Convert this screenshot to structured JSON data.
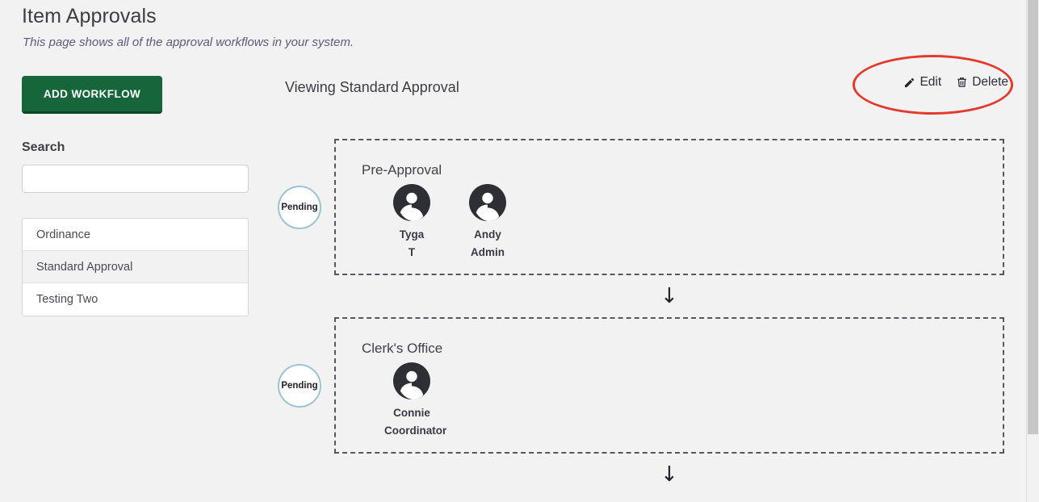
{
  "page": {
    "title": "Item Approvals",
    "subtitle": "This page shows all of the approval workflows in your system.",
    "background_color": "#f2f2f2"
  },
  "sidebar": {
    "add_workflow_label": "ADD WORKFLOW",
    "add_workflow_color": "#17653a",
    "search_label": "Search",
    "search_value": "",
    "search_placeholder": "",
    "workflows": [
      {
        "label": "Ordinance",
        "selected": false
      },
      {
        "label": "Standard Approval",
        "selected": true
      },
      {
        "label": "Testing Two",
        "selected": false
      }
    ]
  },
  "main": {
    "viewing_title": "Viewing Standard Approval",
    "actions": [
      {
        "label": "Edit",
        "icon": "pencil-icon"
      },
      {
        "label": "Delete",
        "icon": "trash-icon"
      }
    ],
    "annotation": {
      "shape": "ellipse",
      "color": "#e23b2e",
      "target": "edit-delete-actions"
    },
    "steps": [
      {
        "status": "Pending",
        "status_border_color": "#9dc3d4",
        "title": "Pre-Approval",
        "approvers": [
          {
            "first_name": "Tyga",
            "last_name": "T",
            "icon": "account-circle-icon"
          },
          {
            "first_name": "Andy",
            "last_name": "Admin",
            "icon": "account-circle-icon"
          }
        ]
      },
      {
        "status": "Pending",
        "status_border_color": "#9dc3d4",
        "title": "Clerk's Office",
        "approvers": [
          {
            "first_name": "Connie",
            "last_name": "Coordinator",
            "icon": "account-circle-icon"
          }
        ]
      }
    ],
    "arrow_glyph": "↓"
  },
  "scrollbar": {
    "orientation": "vertical",
    "thumb_color": "#c6c6c6"
  }
}
